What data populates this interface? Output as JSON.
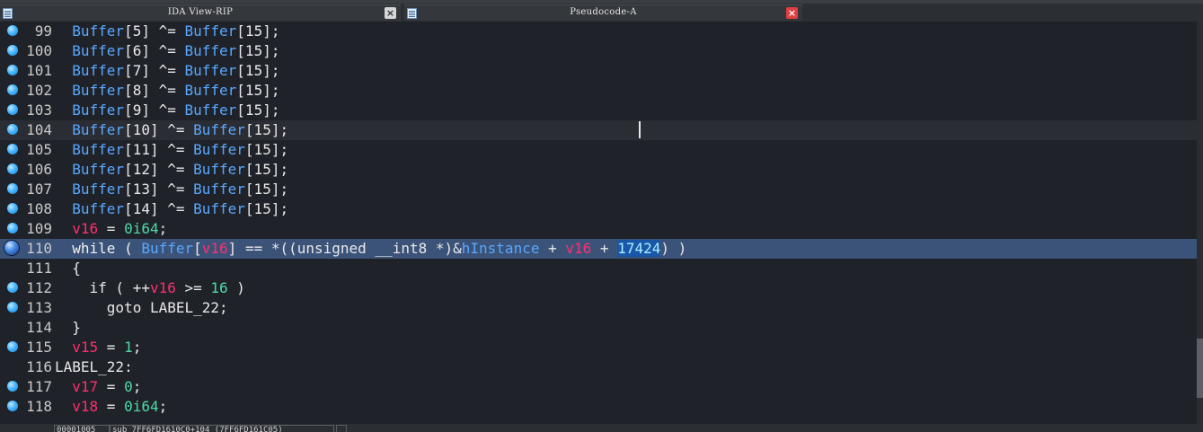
{
  "tabs": [
    {
      "title": "IDA View-RIP",
      "close": "×"
    },
    {
      "title": "Pseudocode-A",
      "close": "×"
    }
  ],
  "lines": [
    {
      "num": "99",
      "tokens": [
        [
          "  ",
          "t"
        ],
        [
          "Buffer",
          "v"
        ],
        [
          "[5] ^= ",
          "t"
        ],
        [
          "Buffer",
          "v"
        ],
        [
          "[15];",
          "t"
        ]
      ]
    },
    {
      "num": "100",
      "tokens": [
        [
          "  ",
          "t"
        ],
        [
          "Buffer",
          "v"
        ],
        [
          "[6] ^= ",
          "t"
        ],
        [
          "Buffer",
          "v"
        ],
        [
          "[15];",
          "t"
        ]
      ]
    },
    {
      "num": "101",
      "tokens": [
        [
          "  ",
          "t"
        ],
        [
          "Buffer",
          "v"
        ],
        [
          "[7] ^= ",
          "t"
        ],
        [
          "Buffer",
          "v"
        ],
        [
          "[15];",
          "t"
        ]
      ]
    },
    {
      "num": "102",
      "tokens": [
        [
          "  ",
          "t"
        ],
        [
          "Buffer",
          "v"
        ],
        [
          "[8] ^= ",
          "t"
        ],
        [
          "Buffer",
          "v"
        ],
        [
          "[15];",
          "t"
        ]
      ]
    },
    {
      "num": "103",
      "tokens": [
        [
          "  ",
          "t"
        ],
        [
          "Buffer",
          "v"
        ],
        [
          "[9] ^= ",
          "t"
        ],
        [
          "Buffer",
          "v"
        ],
        [
          "[15];",
          "t"
        ]
      ]
    },
    {
      "num": "104",
      "tokens": [
        [
          "  ",
          "t"
        ],
        [
          "Buffer",
          "v"
        ],
        [
          "[10] ^= ",
          "t"
        ],
        [
          "Buffer",
          "v"
        ],
        [
          "[15];",
          "t"
        ]
      ],
      "state": "cur"
    },
    {
      "num": "105",
      "tokens": [
        [
          "  ",
          "t"
        ],
        [
          "Buffer",
          "v"
        ],
        [
          "[11] ^= ",
          "t"
        ],
        [
          "Buffer",
          "v"
        ],
        [
          "[15];",
          "t"
        ]
      ]
    },
    {
      "num": "106",
      "tokens": [
        [
          "  ",
          "t"
        ],
        [
          "Buffer",
          "v"
        ],
        [
          "[12] ^= ",
          "t"
        ],
        [
          "Buffer",
          "v"
        ],
        [
          "[15];",
          "t"
        ]
      ]
    },
    {
      "num": "107",
      "tokens": [
        [
          "  ",
          "t"
        ],
        [
          "Buffer",
          "v"
        ],
        [
          "[13] ^= ",
          "t"
        ],
        [
          "Buffer",
          "v"
        ],
        [
          "[15];",
          "t"
        ]
      ]
    },
    {
      "num": "108",
      "tokens": [
        [
          "  ",
          "t"
        ],
        [
          "Buffer",
          "v"
        ],
        [
          "[14] ^= ",
          "t"
        ],
        [
          "Buffer",
          "v"
        ],
        [
          "[15];",
          "t"
        ]
      ]
    },
    {
      "num": "109",
      "tokens": [
        [
          "  ",
          "t"
        ],
        [
          "v16",
          "r"
        ],
        [
          " = ",
          "t"
        ],
        [
          "0i64",
          "n"
        ],
        [
          ";",
          "t"
        ]
      ]
    },
    {
      "num": "110",
      "tokens": [
        [
          "  while ( ",
          "k"
        ],
        [
          "Buffer",
          "v"
        ],
        [
          "[",
          "t"
        ],
        [
          "v16",
          "r"
        ],
        [
          "] == *((unsigned __int8 *)&",
          "t"
        ],
        [
          "hInstance",
          "v"
        ],
        [
          " + ",
          "t"
        ],
        [
          "v16",
          "r"
        ],
        [
          " + ",
          "t"
        ],
        [
          "17424",
          "hl"
        ],
        [
          ") )",
          "t"
        ]
      ],
      "state": "sel",
      "breakpoint": true
    },
    {
      "num": "111",
      "tokens": [
        [
          "  {",
          "t"
        ]
      ],
      "nodot": true
    },
    {
      "num": "112",
      "tokens": [
        [
          "    if ( ++",
          "t"
        ],
        [
          "v16",
          "r"
        ],
        [
          " >= ",
          "t"
        ],
        [
          "16",
          "n"
        ],
        [
          " )",
          "t"
        ]
      ]
    },
    {
      "num": "113",
      "tokens": [
        [
          "      goto LABEL_22;",
          "t"
        ]
      ]
    },
    {
      "num": "114",
      "tokens": [
        [
          "  }",
          "t"
        ]
      ],
      "nodot": true
    },
    {
      "num": "115",
      "tokens": [
        [
          "  ",
          "t"
        ],
        [
          "v15",
          "r"
        ],
        [
          " = ",
          "t"
        ],
        [
          "1",
          "n"
        ],
        [
          ";",
          "t"
        ]
      ]
    },
    {
      "num": "116",
      "tokens": [
        [
          "LABEL_22:",
          "t"
        ]
      ],
      "nodot": true
    },
    {
      "num": "117",
      "tokens": [
        [
          "  ",
          "t"
        ],
        [
          "v17",
          "r"
        ],
        [
          " = ",
          "t"
        ],
        [
          "0",
          "n"
        ],
        [
          ";",
          "t"
        ]
      ]
    },
    {
      "num": "118",
      "tokens": [
        [
          "  ",
          "t"
        ],
        [
          "v18",
          "r"
        ],
        [
          " = ",
          "t"
        ],
        [
          "0i64",
          "n"
        ],
        [
          ";",
          "t"
        ]
      ]
    }
  ],
  "status": {
    "offset": "00001005",
    "location": "sub_7FF6FD1610C0+104 (7FF6FD161C05)"
  }
}
